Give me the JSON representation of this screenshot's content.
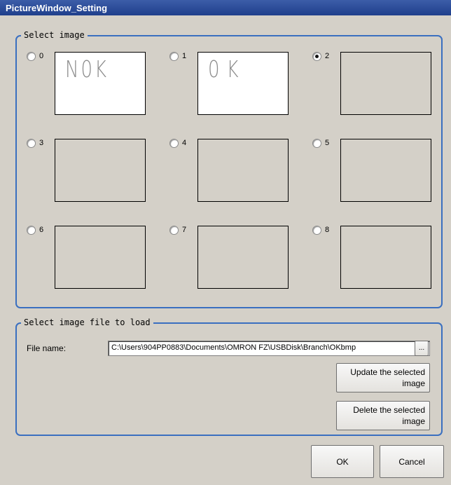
{
  "window": {
    "title": "PictureWindow_Setting"
  },
  "select_image": {
    "legend": "Select image",
    "items": [
      {
        "label": "0",
        "checked": false,
        "hand_text": "N0K"
      },
      {
        "label": "1",
        "checked": false,
        "hand_text": "0K"
      },
      {
        "label": "2",
        "checked": true,
        "hand_text": ""
      },
      {
        "label": "3",
        "checked": false,
        "hand_text": ""
      },
      {
        "label": "4",
        "checked": false,
        "hand_text": ""
      },
      {
        "label": "5",
        "checked": false,
        "hand_text": ""
      },
      {
        "label": "6",
        "checked": false,
        "hand_text": ""
      },
      {
        "label": "7",
        "checked": false,
        "hand_text": ""
      },
      {
        "label": "8",
        "checked": false,
        "hand_text": ""
      }
    ]
  },
  "load": {
    "legend": "Select image file to load",
    "file_label": "File name:",
    "file_value": "C:\\Users\\904PP0883\\Documents\\OMRON FZ\\USBDisk\\Branch\\OKbmp",
    "browse_label": "...",
    "update_label": "Update the selected image",
    "delete_label": "Delete the selected image"
  },
  "footer": {
    "ok_label": "OK",
    "cancel_label": "Cancel"
  },
  "colors": {
    "title_bg": "#2a4a98",
    "group_border": "#3a6fc0",
    "dialog_bg": "#d4d0c8"
  }
}
